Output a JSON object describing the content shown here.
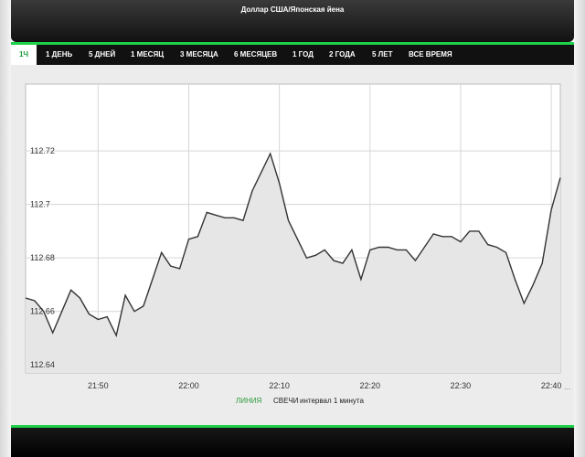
{
  "window": {
    "title": "Доллар США/Японская йена"
  },
  "tabs": [
    {
      "label": "1Ч",
      "active": true
    },
    {
      "label": "1 ДЕНЬ",
      "active": false
    },
    {
      "label": "5 ДНЕЙ",
      "active": false
    },
    {
      "label": "1 МЕСЯЦ",
      "active": false
    },
    {
      "label": "3 МЕСЯЦА",
      "active": false
    },
    {
      "label": "6 МЕСЯЦЕВ",
      "active": false
    },
    {
      "label": "1 ГОД",
      "active": false
    },
    {
      "label": "2 ГОДА",
      "active": false
    },
    {
      "label": "5 ЛЕТ",
      "active": false
    },
    {
      "label": "ВСЕ ВРЕМЯ",
      "active": false
    }
  ],
  "legend": {
    "line_label": "ЛИНИЯ",
    "candles_label": "СВЕЧИ",
    "interval_label": "интервал 1 минута",
    "active_color": "#2a9a3a"
  },
  "colors": {
    "accent": "#1fd14a",
    "line": "#333333",
    "fill": "#e6e6e6"
  },
  "chart_data": {
    "type": "area",
    "title": "",
    "xlabel": "",
    "ylabel": "",
    "grid": true,
    "ylim": [
      112.637,
      112.745
    ],
    "xlim": [
      "21:42",
      "22:41"
    ],
    "x_ticks": [
      "21:50",
      "22:00",
      "22:10",
      "22:20",
      "22:30",
      "22:40"
    ],
    "y_ticks": [
      112.64,
      112.66,
      112.68,
      112.7,
      112.72
    ],
    "x": [
      "21:42",
      "21:43",
      "21:44",
      "21:45",
      "21:46",
      "21:47",
      "21:48",
      "21:49",
      "21:50",
      "21:51",
      "21:52",
      "21:53",
      "21:54",
      "21:55",
      "21:56",
      "21:57",
      "21:58",
      "21:59",
      "22:00",
      "22:01",
      "22:02",
      "22:03",
      "22:04",
      "22:05",
      "22:06",
      "22:07",
      "22:08",
      "22:09",
      "22:10",
      "22:11",
      "22:12",
      "22:13",
      "22:14",
      "22:15",
      "22:16",
      "22:17",
      "22:18",
      "22:19",
      "22:20",
      "22:21",
      "22:22",
      "22:23",
      "22:24",
      "22:25",
      "22:26",
      "22:27",
      "22:28",
      "22:29",
      "22:30",
      "22:31",
      "22:32",
      "22:33",
      "22:34",
      "22:35",
      "22:36",
      "22:37",
      "22:38",
      "22:39",
      "22:40",
      "22:41"
    ],
    "series": [
      {
        "values": [
          112.665,
          112.664,
          112.66,
          112.652,
          112.66,
          112.668,
          112.665,
          112.659,
          112.657,
          112.658,
          112.651,
          112.666,
          112.66,
          112.662,
          112.672,
          112.682,
          112.677,
          112.676,
          112.687,
          112.688,
          112.697,
          112.696,
          112.695,
          112.695,
          112.694,
          112.705,
          112.712,
          112.719,
          112.708,
          112.694,
          112.687,
          112.68,
          112.681,
          112.683,
          112.679,
          112.678,
          112.683,
          112.672,
          112.683,
          112.684,
          112.684,
          112.683,
          112.683,
          112.679,
          112.684,
          112.689,
          112.688,
          112.688,
          112.686,
          112.69,
          112.69,
          112.685,
          112.684,
          112.682,
          112.672,
          112.663,
          112.67,
          112.678,
          112.698,
          112.71
        ]
      }
    ]
  }
}
